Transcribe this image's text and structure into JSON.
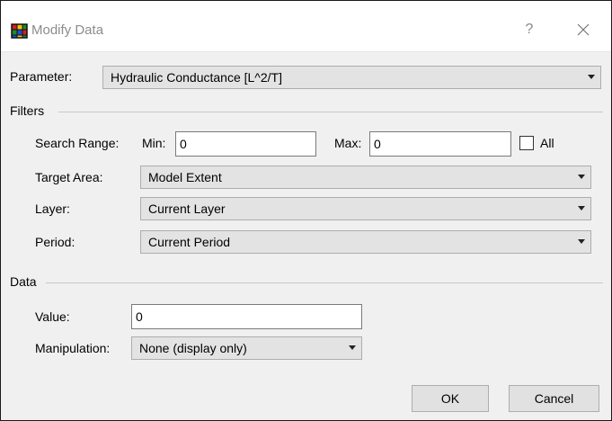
{
  "window": {
    "title": "Modify Data",
    "help_label": "?"
  },
  "parameter": {
    "label": "Parameter:",
    "value": "Hydraulic Conductance [L^2/T]"
  },
  "filters": {
    "group_label": "Filters",
    "search_range_label": "Search Range:",
    "min_label": "Min:",
    "min_value": "0",
    "max_label": "Max:",
    "max_value": "0",
    "all_label": "All",
    "all_checked": false,
    "target_area_label": "Target Area:",
    "target_area_value": "Model Extent",
    "layer_label": "Layer:",
    "layer_value": "Current Layer",
    "period_label": "Period:",
    "period_value": "Current Period"
  },
  "data_group": {
    "group_label": "Data",
    "value_label": "Value:",
    "value": "0",
    "manipulation_label": "Manipulation:",
    "manipulation_value": "None (display only)"
  },
  "buttons": {
    "ok": "OK",
    "cancel": "Cancel"
  },
  "icons": {
    "app": "modify-data-app-icon",
    "close": "close-icon",
    "dropdown": "chevron-down-icon"
  }
}
